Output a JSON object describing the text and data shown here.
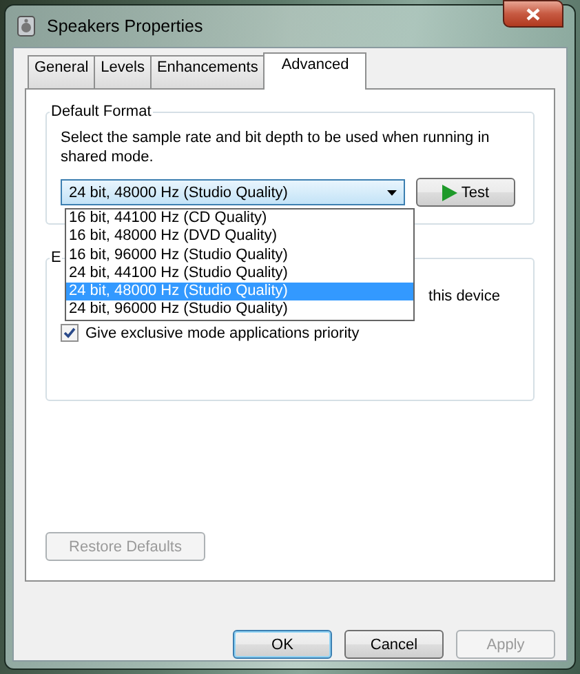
{
  "window": {
    "title": "Speakers Properties"
  },
  "tabs": [
    {
      "label": "General",
      "selected": false
    },
    {
      "label": "Levels",
      "selected": false
    },
    {
      "label": "Enhancements",
      "selected": false
    },
    {
      "label": "Advanced",
      "selected": true
    }
  ],
  "default_format": {
    "label": "Default Format",
    "description": "Select the sample rate and bit depth to be used when running in shared mode.",
    "value": "24 bit, 48000 Hz (Studio Quality)",
    "test_button": "Test",
    "options": [
      {
        "label": "16 bit, 44100 Hz (CD Quality)",
        "selected": false
      },
      {
        "label": "16 bit, 48000 Hz (DVD Quality)",
        "selected": false
      },
      {
        "label": "16 bit, 96000 Hz (Studio Quality)",
        "selected": false
      },
      {
        "label": "24 bit, 44100 Hz (Studio Quality)",
        "selected": false
      },
      {
        "label": "24 bit, 48000 Hz (Studio Quality)",
        "selected": true
      },
      {
        "label": "24 bit, 96000 Hz (Studio Quality)",
        "selected": false
      }
    ]
  },
  "exclusive_mode": {
    "label": "E",
    "text": "this device",
    "checkbox": {
      "label": "Give exclusive mode applications priority",
      "checked": true
    }
  },
  "restore_defaults": {
    "label": "Restore Defaults",
    "disabled": true
  },
  "buttons": [
    {
      "label": "OK",
      "kind": "default",
      "disabled": false
    },
    {
      "label": "Cancel",
      "kind": "normal",
      "disabled": false
    },
    {
      "label": "Apply",
      "kind": "normal",
      "disabled": true
    }
  ]
}
